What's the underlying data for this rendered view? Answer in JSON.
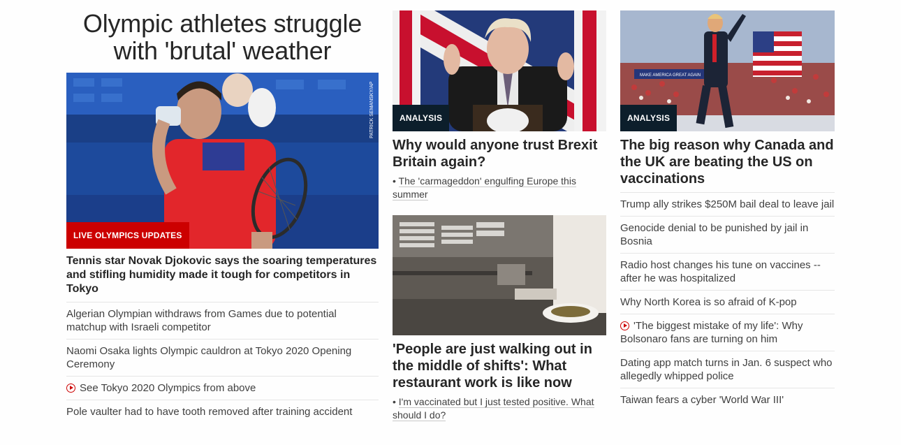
{
  "col1": {
    "headline": "Olympic athletes struggle with 'brutal' weather",
    "image_credit": "PATRICK SEMANSKY/AP",
    "image_label": "LIVE OLYMPICS UPDATES",
    "lead": "Tennis star Novak Djokovic says the soaring temperatures and stifling humidity made it tough for competitors in Tokyo",
    "items": [
      "Algerian Olympian withdraws from Games due to potential matchup with Israeli competitor",
      "Naomi Osaka lights Olympic cauldron at Tokyo 2020 Opening Ceremony",
      "See Tokyo 2020 Olympics from above",
      "Pole vaulter had to have tooth removed after training accident"
    ]
  },
  "col2": {
    "story1": {
      "label": "ANALYSIS",
      "title": "Why would anyone trust Brexit Britain again?",
      "related": "The 'carmageddon' engulfing Europe this summer"
    },
    "story2": {
      "title": "'People are just walking out in the middle of shifts': What restaurant work is like now",
      "related": "I'm vaccinated but I just tested positive. What should I do?"
    }
  },
  "col3": {
    "label": "ANALYSIS",
    "title": "The big reason why Canada and the UK are beating the US on vaccinations",
    "image_sign": "MAKE AMERICA GREAT AGAIN",
    "items": [
      "Trump ally strikes $250M bail deal to leave jail",
      "Genocide denial to be punished by jail in Bosnia",
      "Radio host changes his tune on vaccines -- after he was hospitalized",
      "Why North Korea is so afraid of K-pop",
      "'The biggest mistake of my life': Why Bolsonaro fans are turning on him",
      "Dating app match turns in Jan. 6 suspect who allegedly whipped police",
      "Taiwan fears a cyber 'World War III'"
    ]
  },
  "colors": {
    "live_red": "#cc0000",
    "analysis_navy": "#0c1e2b"
  }
}
